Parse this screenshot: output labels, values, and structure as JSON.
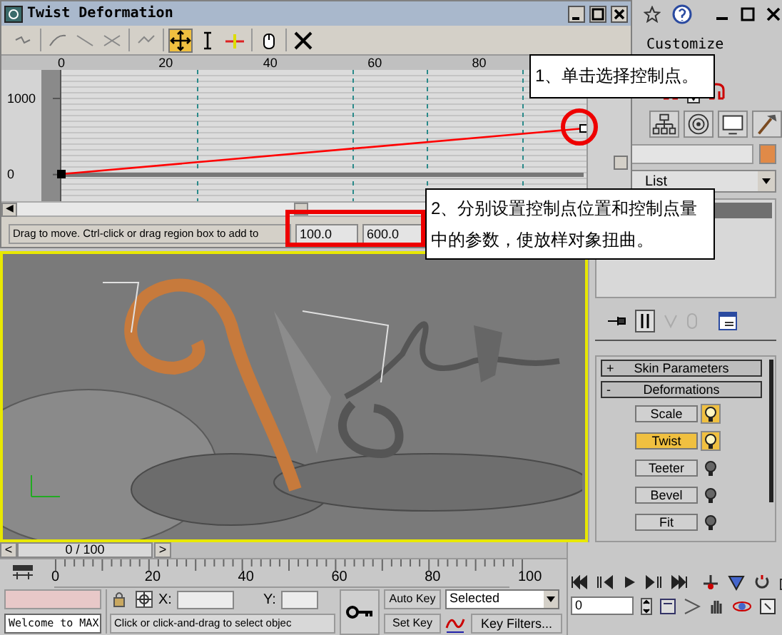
{
  "dialog": {
    "title": "Twist Deformation",
    "toolbar": [
      {
        "kind": "link",
        "selected": false
      },
      {
        "kind": "curve",
        "selected": false
      },
      {
        "kind": "line",
        "selected": false
      },
      {
        "kind": "cross",
        "selected": false
      },
      {
        "kind": "insert",
        "selected": false
      },
      {
        "kind": "move",
        "selected": true
      },
      {
        "kind": "scale",
        "selected": false
      },
      {
        "kind": "insert-point",
        "selected": false
      },
      {
        "kind": "hand",
        "selected": false
      },
      {
        "kind": "delete",
        "selected": false
      }
    ],
    "chart_data": {
      "type": "line",
      "x": [
        0,
        100
      ],
      "series": [
        {
          "color": "#ff0000",
          "values": [
            0,
            600
          ],
          "marker": "square"
        }
      ],
      "ref_lines": [
        {
          "axis": "x",
          "value": 26
        },
        {
          "axis": "x",
          "value": 56
        },
        {
          "axis": "x",
          "value": 70
        },
        {
          "axis": "x",
          "value": 88.5
        },
        {
          "axis": "y",
          "value": 0
        }
      ],
      "xticks": [
        0,
        20,
        40,
        60,
        80
      ],
      "yticks": [
        0,
        1000
      ],
      "xlim": [
        0,
        100
      ],
      "ylim": [
        -350,
        1375
      ]
    },
    "scroll_left": "◀",
    "status": "Drag to move. Ctrl-click or drag region box to add to",
    "fields": [
      "100.0",
      "600.0"
    ]
  },
  "annotations": [
    {
      "text": "1、单击选择控制点。"
    },
    {
      "text": "2、分别设置控制点位置和控制点量中的参数，使放样对象扭曲。"
    }
  ],
  "menu": {
    "item": "Customize"
  },
  "command_panel": {
    "list_label": "List",
    "rollouts": [
      {
        "sign": "+",
        "title": "Skin Parameters"
      },
      {
        "sign": "-",
        "title": "Deformations"
      }
    ],
    "deformations": [
      {
        "label": "Scale",
        "selected": false,
        "on": true
      },
      {
        "label": "Twist",
        "selected": true,
        "on": true
      },
      {
        "label": "Teeter",
        "selected": false,
        "on": false
      },
      {
        "label": "Bevel",
        "selected": false,
        "on": false
      },
      {
        "label": "Fit",
        "selected": false,
        "on": false
      }
    ]
  },
  "time_slider": {
    "prev": "<",
    "position": "0 / 100",
    "next": ">",
    "level": 0
  },
  "trackbar_labels": [
    "0",
    "20",
    "40",
    "60",
    "80",
    "100"
  ],
  "status_bar": {
    "maxscript": "Welcome to MAX",
    "prompt": "Click or click-and-drag to select objec",
    "x_label": "X:",
    "y_label": "Y:",
    "auto_key": "Auto Key",
    "set_key": "Set Key",
    "key_mode": "Selected",
    "key_filters": "Key Filters...",
    "frame": "0"
  }
}
